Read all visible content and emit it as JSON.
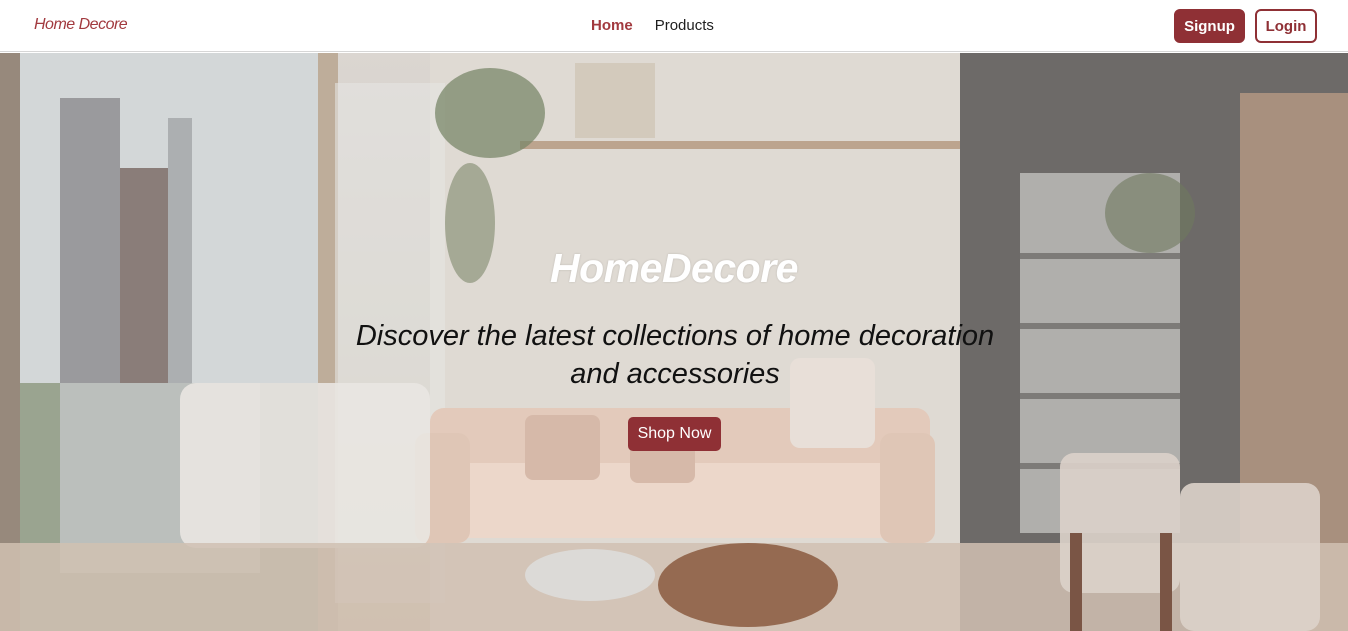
{
  "navbar": {
    "brand": "Home Decore",
    "links": [
      {
        "label": "Home",
        "active": true
      },
      {
        "label": "Products",
        "active": false
      }
    ],
    "signup_label": "Signup",
    "login_label": "Login"
  },
  "hero": {
    "title": "HomeDecore",
    "subtitle": "Discover the latest collections of home decoration and accessories",
    "cta_label": "Shop Now"
  },
  "colors": {
    "accent": "#8f3035",
    "brand_text": "#a23a3f"
  }
}
